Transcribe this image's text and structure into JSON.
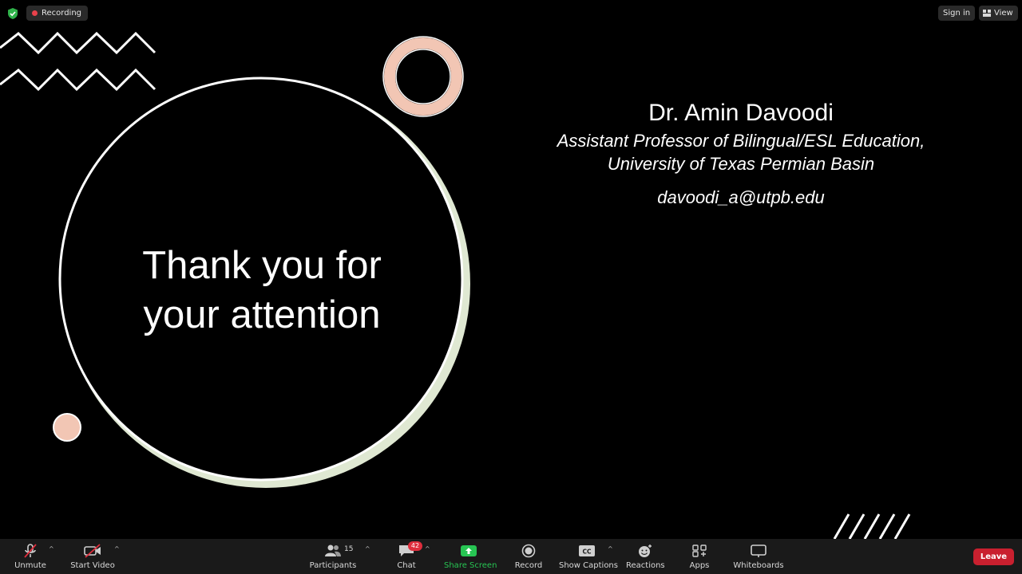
{
  "topbar": {
    "recording_label": "Recording",
    "signin_label": "Sign in",
    "view_label": "View"
  },
  "slide": {
    "thanks_line1": "Thank you for",
    "thanks_line2": "your attention",
    "speaker_name": "Dr. Amin Davoodi",
    "speaker_title": "Assistant Professor of Bilingual/ESL Education,",
    "speaker_org": "University of Texas Permian Basin",
    "speaker_email": "davoodi_a@utpb.edu"
  },
  "toolbar": {
    "unmute": "Unmute",
    "start_video": "Start Video",
    "participants": "Participants",
    "participants_count": "15",
    "chat": "Chat",
    "chat_badge": "42",
    "share_screen": "Share Screen",
    "record": "Record",
    "show_captions": "Show Captions",
    "reactions": "Reactions",
    "apps": "Apps",
    "whiteboards": "Whiteboards",
    "leave": "Leave"
  },
  "colors": {
    "background": "#000000",
    "toolbar_bg": "#1a1a1a",
    "share_green": "#27c553",
    "leave_red": "#c9202f",
    "badge_red": "#e02e3d",
    "peach": "#f2c6b4",
    "sage": "#dfe8d2"
  }
}
